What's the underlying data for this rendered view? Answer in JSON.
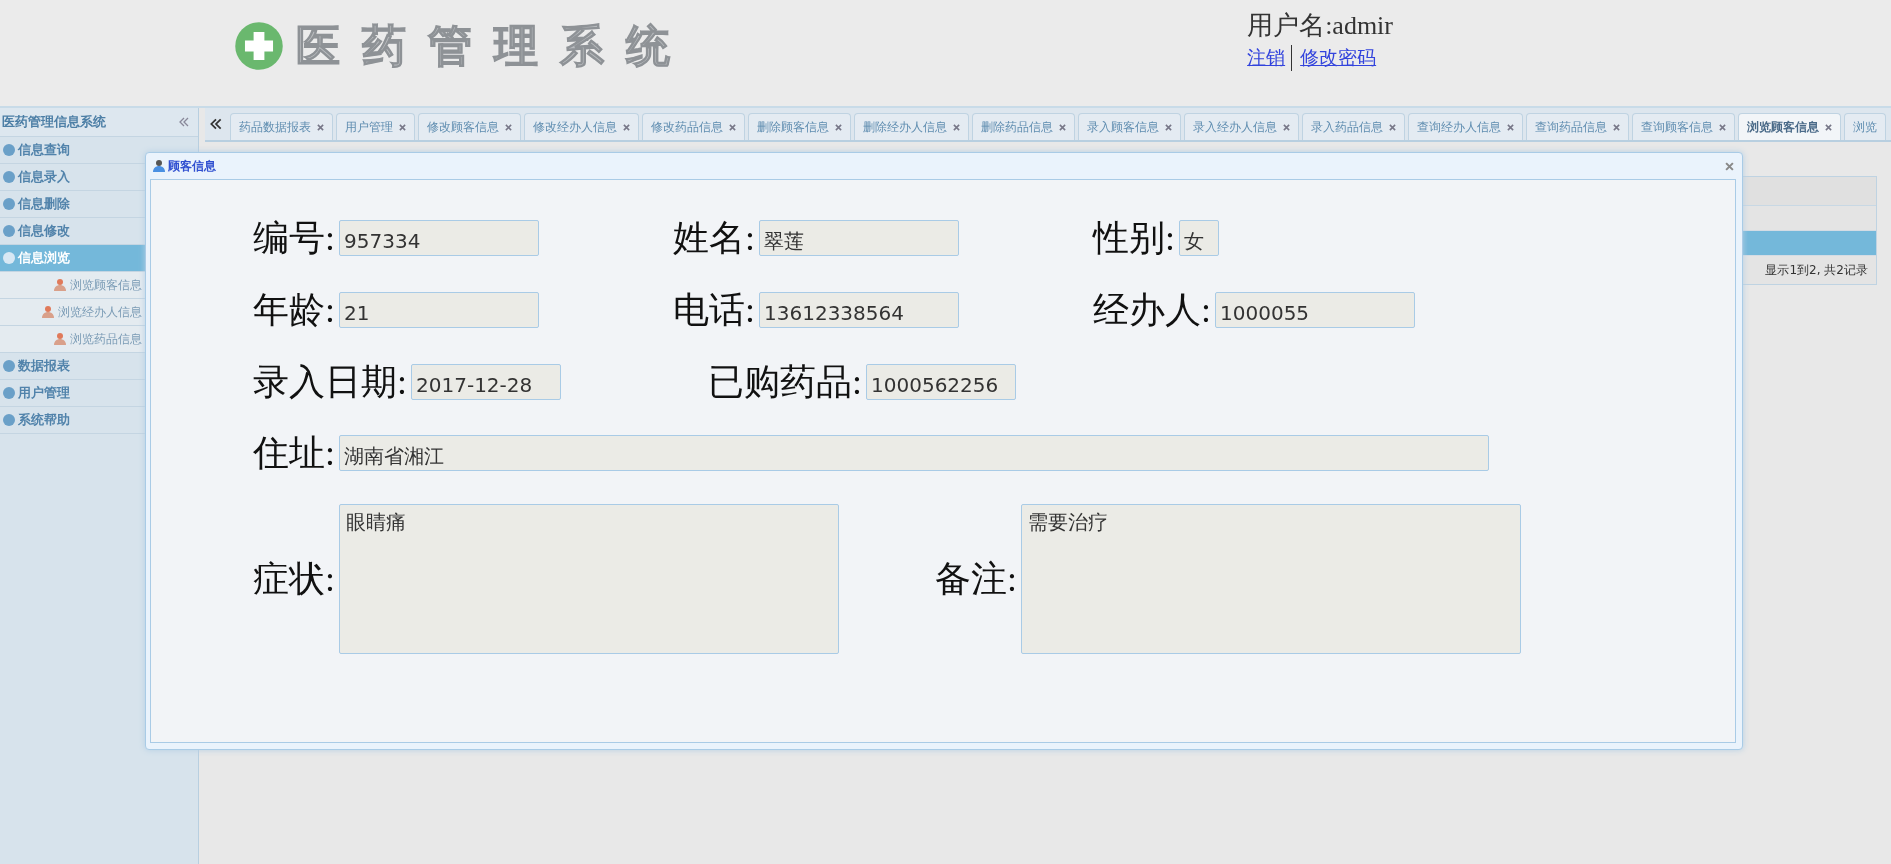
{
  "header": {
    "title": "医药管理系统",
    "user_label": "用户名:admir",
    "links": [
      "注销",
      "修改密码"
    ]
  },
  "sidebar": {
    "title": "医药管理信息系统",
    "items": [
      {
        "label": "信息查询",
        "kind": "group",
        "selected": false
      },
      {
        "label": "信息录入",
        "kind": "group",
        "selected": false
      },
      {
        "label": "信息删除",
        "kind": "group",
        "selected": false
      },
      {
        "label": "信息修改",
        "kind": "group",
        "selected": false
      },
      {
        "label": "信息浏览",
        "kind": "group",
        "selected": true
      },
      {
        "label": "浏览顾客信息",
        "kind": "sub",
        "selected": false
      },
      {
        "label": "浏览经办人信息",
        "kind": "sub",
        "selected": false
      },
      {
        "label": "浏览药品信息",
        "kind": "sub",
        "selected": false
      },
      {
        "label": "数据报表",
        "kind": "group",
        "selected": false
      },
      {
        "label": "用户管理",
        "kind": "group",
        "selected": false
      },
      {
        "label": "系统帮助",
        "kind": "group",
        "selected": false
      }
    ]
  },
  "tabs": [
    {
      "label": "药品数据报表",
      "selected": false
    },
    {
      "label": "用户管理",
      "selected": false
    },
    {
      "label": "修改顾客信息",
      "selected": false
    },
    {
      "label": "修改经办人信息",
      "selected": false
    },
    {
      "label": "修改药品信息",
      "selected": false
    },
    {
      "label": "删除顾客信息",
      "selected": false
    },
    {
      "label": "删除经办人信息",
      "selected": false
    },
    {
      "label": "删除药品信息",
      "selected": false
    },
    {
      "label": "录入顾客信息",
      "selected": false
    },
    {
      "label": "录入经办人信息",
      "selected": false
    },
    {
      "label": "录入药品信息",
      "selected": false
    },
    {
      "label": "查询经办人信息",
      "selected": false
    },
    {
      "label": "查询药品信息",
      "selected": false
    },
    {
      "label": "查询顾客信息",
      "selected": false
    },
    {
      "label": "浏览顾客信息",
      "selected": true
    },
    {
      "label": "浏览",
      "selected": false
    }
  ],
  "table": {
    "rows": [
      {
        "selected": false
      },
      {
        "selected": true
      }
    ],
    "footer": "显示1到2, 共2记录"
  },
  "dialog": {
    "title": "顾客信息",
    "rows": [
      [
        {
          "label": "编号:",
          "value": "957334"
        },
        {
          "label": "姓名:",
          "value": "翠莲"
        },
        {
          "label": "性别:",
          "value": "女"
        }
      ],
      [
        {
          "label": "年龄:",
          "value": "21"
        },
        {
          "label": "电话:",
          "value": "13612338564"
        },
        {
          "label": "经办人:",
          "value": "1000055"
        }
      ],
      [
        {
          "label": "录入日期:",
          "value": "2017-12-28"
        },
        {
          "label": "已购药品:",
          "value": "1000562256"
        }
      ],
      [
        {
          "label": "住址:",
          "value": "湖南省湘江"
        }
      ]
    ],
    "areas": [
      {
        "label": "症状:",
        "value": "眼睛痛"
      },
      {
        "label": "备注:",
        "value": "需要治疗"
      }
    ]
  }
}
